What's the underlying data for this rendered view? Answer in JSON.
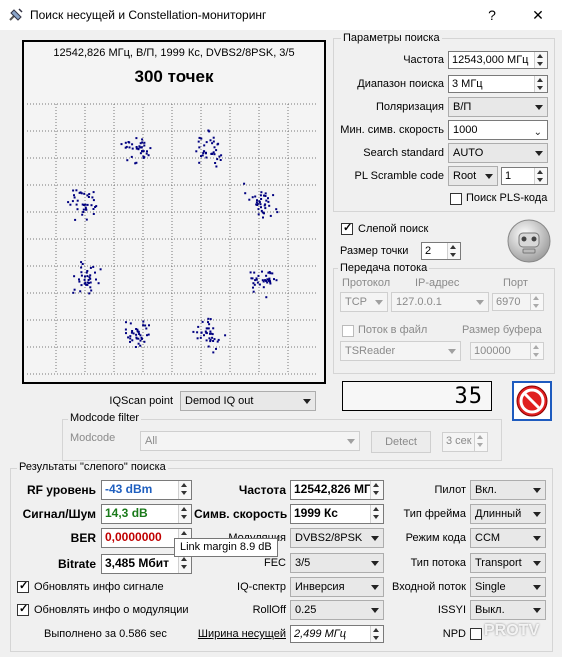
{
  "window": {
    "title": "Поиск несущей и Constellation-мониторинг",
    "help_label": "?",
    "close_label": "✕"
  },
  "constellation": {
    "header": "12542,826 МГц, В/П, 1999 Кс, DVBS2/8PSK, 3/5",
    "points_label": "300 точек",
    "point_color": "#000080"
  },
  "search_params": {
    "title": "Параметры поиска",
    "frequency_label": "Частота",
    "frequency_value": "12543,000 МГц",
    "range_label": "Диапазон поиска",
    "range_value": "3 МГц",
    "polarization_label": "Поляризация",
    "polarization_value": "В/П",
    "min_sr_label": "Мин. симв. скорость",
    "min_sr_value": "1000",
    "standard_label": "Search standard",
    "standard_value": "AUTO",
    "pls_label": "PL Scramble code",
    "pls_mode_value": "Root",
    "pls_code_value": "1",
    "pls_search_label": "Поиск PLS-кода"
  },
  "blind": {
    "blind_search_label": "Слепой поиск",
    "point_size_label": "Размер точки",
    "point_size_value": "2"
  },
  "stream": {
    "title": "Передача потока",
    "protocol_label": "Протокол",
    "ip_label": "IP-адрес",
    "port_label": "Порт",
    "protocol_value": "TCP",
    "ip_value": "127.0.0.1",
    "port_value": "6970",
    "file_label": "Поток в файл",
    "buffer_label": "Размер буфера",
    "reader_value": "TSReader",
    "buffer_value": "100000"
  },
  "counter": {
    "value": "35"
  },
  "iqscan": {
    "label": "IQScan point",
    "value": "Demod IQ out"
  },
  "modcode_filter": {
    "title": "Modcode filter",
    "modcode_label": "Modcode",
    "modcode_value": "All",
    "detect_label": "Detect",
    "time_value": "3 сек"
  },
  "results": {
    "title": "Результаты \"слепого\" поиска",
    "rf_label": "RF уровень",
    "rf_value": "-43 dBm",
    "rf_color": "#1f5fbf",
    "snr_label": "Сигнал/Шум",
    "snr_value": "14,3 dB",
    "snr_color": "#1a7a1a",
    "ber_label": "BER",
    "ber_value": "0,0000000",
    "ber_color": "#c00000",
    "bitrate_label": "Bitrate",
    "bitrate_value": "3,485 Мбит",
    "freq_label": "Частота",
    "freq_value": "12542,826 МГ",
    "sr_label": "Симв. скорость",
    "sr_value": "1999 Кс",
    "modulation_label": "Модуляция",
    "modulation_value": "DVBS2/8PSK",
    "fec_label": "FEC",
    "fec_value": "3/5",
    "iq_label": "IQ-спектр",
    "iq_value": "Инверсия",
    "rolloff_label": "RollOff",
    "rolloff_value": "0.25",
    "bw_label": "Ширина несущей",
    "bw_value": "2,499 МГц",
    "pilot_label": "Пилот",
    "pilot_value": "Вкл.",
    "frame_label": "Тип фрейма",
    "frame_value": "Длинный",
    "code_mode_label": "Режим кода",
    "code_mode_value": "CCM",
    "stream_type_label": "Тип потока",
    "stream_type_value": "Transport",
    "input_stream_label": "Входной поток",
    "input_stream_value": "Single",
    "issyi_label": "ISSYI",
    "issyi_value": "Выкл.",
    "npd_label": "NPD",
    "update_signal_label": "Обновлять инфо сигнале",
    "update_mod_label": "Обновлять инфо о модуляции",
    "elapsed_label": "Выполнено за 0.586 sec"
  },
  "tooltip": {
    "text": "Link margin 8.9 dB"
  },
  "watermark": {
    "text": "PROTV"
  }
}
